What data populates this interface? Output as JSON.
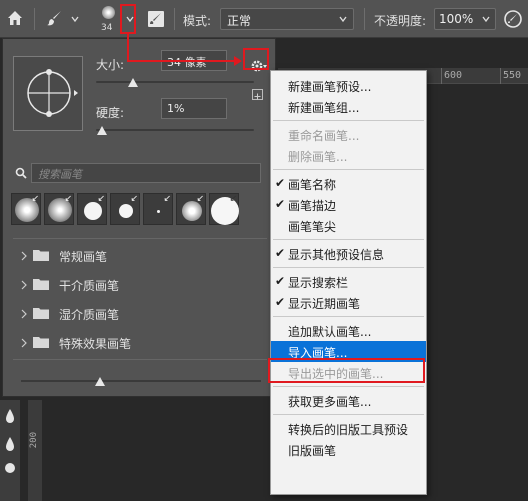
{
  "options_bar": {
    "brush_size_display": "34",
    "mode_label": "模式:",
    "mode_value": "正常",
    "opacity_label": "不透明度:",
    "opacity_value": "100%"
  },
  "ruler": {
    "h_labels": [
      "600",
      "550"
    ],
    "v_label": "200"
  },
  "brush_panel": {
    "size_label": "大小:",
    "size_value": "34 像素",
    "size_level": 0.34,
    "hardness_label": "硬度:",
    "hardness_value": "1%",
    "hardness_level": 0.01,
    "search_placeholder": "搜索画笔",
    "folders": [
      {
        "name": "常规画笔"
      },
      {
        "name": "干介质画笔"
      },
      {
        "name": "湿介质画笔"
      },
      {
        "name": "特殊效果画笔"
      }
    ]
  },
  "menu": {
    "items": [
      {
        "label": "新建画笔预设...",
        "enabled": true,
        "checked": false
      },
      {
        "label": "新建画笔组...",
        "enabled": true,
        "checked": false
      },
      {
        "sep": true
      },
      {
        "label": "重命名画笔...",
        "enabled": false,
        "checked": false
      },
      {
        "label": "删除画笔...",
        "enabled": false,
        "checked": false
      },
      {
        "sep": true
      },
      {
        "label": "画笔名称",
        "enabled": true,
        "checked": true
      },
      {
        "label": "画笔描边",
        "enabled": true,
        "checked": true
      },
      {
        "label": "画笔笔尖",
        "enabled": true,
        "checked": false
      },
      {
        "sep": true
      },
      {
        "label": "显示其他预设信息",
        "enabled": true,
        "checked": true
      },
      {
        "sep": true
      },
      {
        "label": "显示搜索栏",
        "enabled": true,
        "checked": true
      },
      {
        "label": "显示近期画笔",
        "enabled": true,
        "checked": true
      },
      {
        "sep": true
      },
      {
        "label": "追加默认画笔...",
        "enabled": true,
        "checked": false
      },
      {
        "label": "导入画笔...",
        "enabled": true,
        "checked": false,
        "selected": true
      },
      {
        "label": "导出选中的画笔...",
        "enabled": false,
        "checked": false
      },
      {
        "sep": true
      },
      {
        "label": "获取更多画笔...",
        "enabled": true,
        "checked": false
      },
      {
        "sep": true
      },
      {
        "label": "转换后的旧版工具预设",
        "enabled": true,
        "checked": false
      },
      {
        "label": "旧版画笔",
        "enabled": true,
        "checked": false
      }
    ]
  },
  "colors": {
    "annotation": "#e0191f",
    "menu_highlight": "#0a72d8"
  }
}
